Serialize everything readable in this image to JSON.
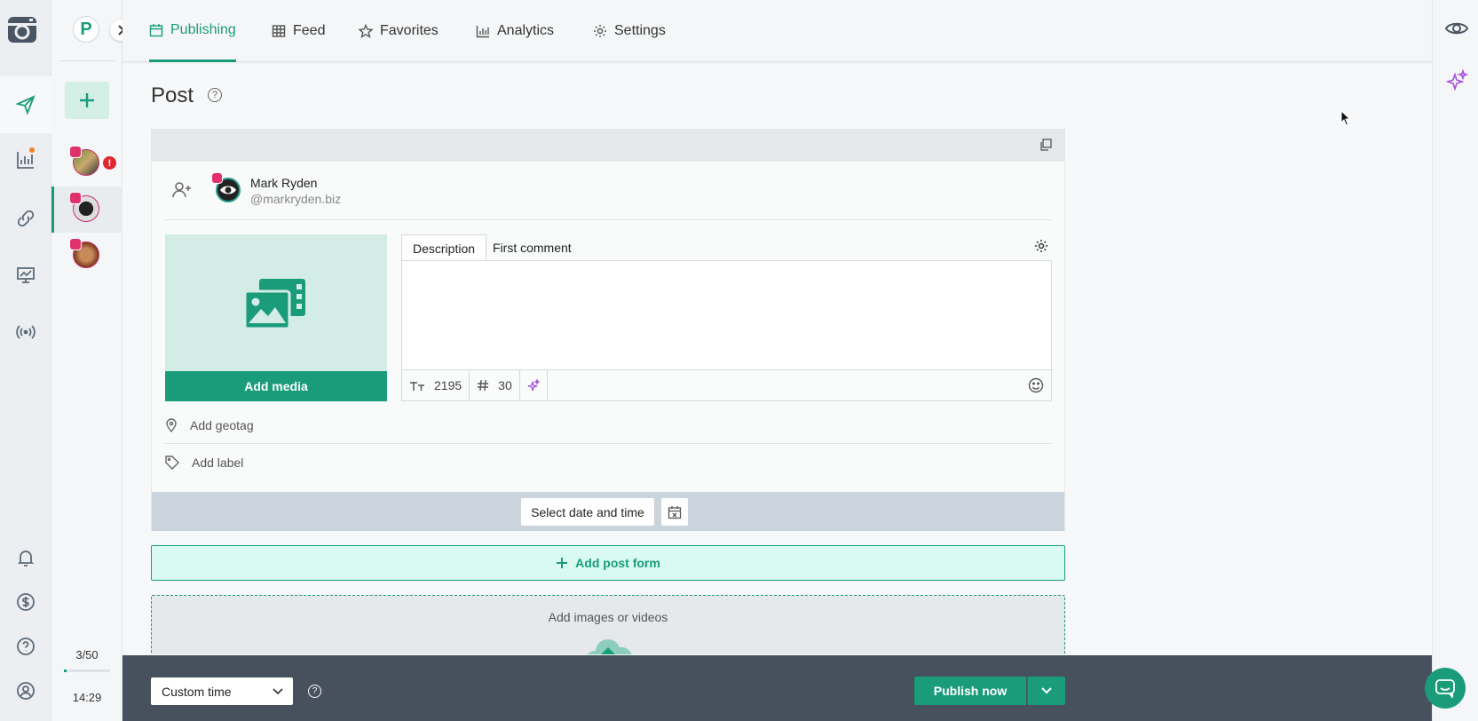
{
  "nav": {
    "tabs": [
      {
        "label": "Publishing",
        "icon": "calendar-icon",
        "active": true
      },
      {
        "label": "Feed",
        "icon": "grid-icon"
      },
      {
        "label": "Favorites",
        "icon": "star-icon"
      },
      {
        "label": "Analytics",
        "icon": "bar-chart-icon"
      },
      {
        "label": "Settings",
        "icon": "gear-icon"
      }
    ]
  },
  "accounts": {
    "workspace_initial": "P",
    "alert_symbol": "!",
    "count": "3/50",
    "progress": 0.06,
    "time": "14:29"
  },
  "post": {
    "title": "Post",
    "help_symbol": "?",
    "profile": {
      "name": "Mark Ryden",
      "handle": "@markryden.biz"
    },
    "add_media": "Add media",
    "editor_tabs": [
      "Description",
      "First comment"
    ],
    "char_count": "2195",
    "hashtag_count": "30",
    "add_geotag": "Add geotag",
    "add_label": "Add label",
    "select_date": "Select date and time"
  },
  "add_post_form": "Add post form",
  "drop_zone": "Add images or videos",
  "bottom": {
    "time_select": "Custom time",
    "publish_now": "Publish now"
  },
  "colors": {
    "accent": "#1a9c7b",
    "bottom_bar": "#47515d",
    "alert": "#e0262e",
    "instagram": "#e1306c"
  }
}
